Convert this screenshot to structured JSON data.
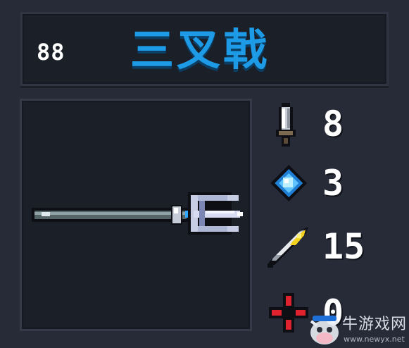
{
  "weapon": {
    "id": "88",
    "name": "三叉戟",
    "sprite_icon": "trident-icon"
  },
  "stats": [
    {
      "name": "attack",
      "icon": "sword-icon",
      "value": "8"
    },
    {
      "name": "energy",
      "icon": "blue-crystal-icon",
      "value": "3"
    },
    {
      "name": "critical",
      "icon": "feather-icon",
      "value": "15"
    },
    {
      "name": "accuracy",
      "icon": "red-crosshair-icon",
      "value": "0"
    }
  ],
  "colors": {
    "background": "#262b37",
    "panel": "#1a1f28",
    "title": "#1e9be6",
    "value": "#ffffff"
  },
  "watermark": {
    "title": "牛游戏网",
    "url": "www.newyx.net"
  }
}
